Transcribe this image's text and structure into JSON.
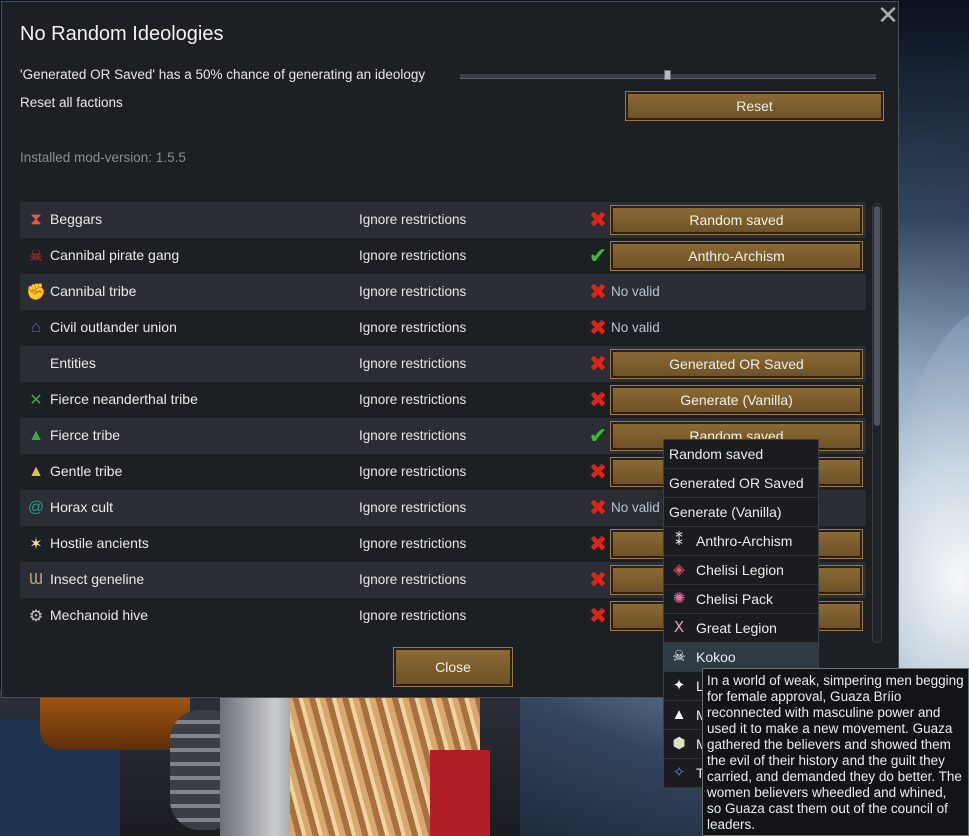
{
  "window": {
    "title": "No Random Ideologies",
    "close_symbol": "✕",
    "chance_label": "'Generated OR Saved' has a 50% chance of generating an ideology",
    "chance_value_percent": 50,
    "reset_all_label": "Reset all factions",
    "reset_button": "Reset",
    "version": "Installed mod-version: 1.5.5",
    "close_button": "Close"
  },
  "factions": [
    {
      "name": "Beggars",
      "icon": "hourglass-icon",
      "icon_color": "#e8554e",
      "ignore_label": "Ignore restrictions",
      "status": "x",
      "value": "Random saved",
      "value_type": "button"
    },
    {
      "name": "Cannibal pirate gang",
      "icon": "skull-icon",
      "icon_color": "#d0323a",
      "ignore_label": "Ignore restrictions",
      "status": "check",
      "value": "Anthro-Archism",
      "value_type": "button"
    },
    {
      "name": "Cannibal tribe",
      "icon": "fist-icon",
      "icon_color": "#d8702a",
      "ignore_label": "Ignore restrictions",
      "status": "x",
      "value": "No valid",
      "value_type": "text"
    },
    {
      "name": "Civil outlander union",
      "icon": "house-icon",
      "icon_color": "#6a5cc8",
      "ignore_label": "Ignore restrictions",
      "status": "x",
      "value": "No valid",
      "value_type": "text"
    },
    {
      "name": "Entities",
      "icon": "",
      "icon_color": "",
      "ignore_label": "Ignore restrictions",
      "status": "x",
      "value": "Generated OR Saved",
      "value_type": "button"
    },
    {
      "name": "Fierce neanderthal tribe",
      "icon": "spear-icon",
      "icon_color": "#3aa84a",
      "ignore_label": "Ignore restrictions",
      "status": "x",
      "value": "Generate (Vanilla)",
      "value_type": "button"
    },
    {
      "name": "Fierce tribe",
      "icon": "leaf-icon",
      "icon_color": "#3aa84a",
      "ignore_label": "Ignore restrictions",
      "status": "check",
      "value": "Random saved",
      "value_type": "button"
    },
    {
      "name": "Gentle tribe",
      "icon": "tent-icon",
      "icon_color": "#e0c24a",
      "ignore_label": "Ignore restrictions",
      "status": "x",
      "value": "",
      "value_type": "button"
    },
    {
      "name": "Horax cult",
      "icon": "spiral-icon",
      "icon_color": "#2a9c8a",
      "ignore_label": "Ignore restrictions",
      "status": "x",
      "value": "No valid",
      "value_type": "text"
    },
    {
      "name": "Hostile ancients",
      "icon": "running-figure-icon",
      "icon_color": "#f0e0b0",
      "ignore_label": "Ignore restrictions",
      "status": "x",
      "value": "",
      "value_type": "button"
    },
    {
      "name": "Insect geneline",
      "icon": "claw-icon",
      "icon_color": "#b8a88a",
      "ignore_label": "Ignore restrictions",
      "status": "x",
      "value": "",
      "value_type": "button"
    },
    {
      "name": "Mechanoid hive",
      "icon": "gear-icon",
      "icon_color": "#c8c8c8",
      "ignore_label": "Ignore restrictions",
      "status": "x",
      "value": "",
      "value_type": "button"
    }
  ],
  "dropdown": {
    "items": [
      {
        "label": "Random saved",
        "icon": "",
        "icon_color": ""
      },
      {
        "label": "Generated OR Saved",
        "icon": "",
        "icon_color": ""
      },
      {
        "label": "Generate (Vanilla)",
        "icon": "",
        "icon_color": ""
      },
      {
        "label": "Anthro-Archism",
        "icon": "hands-icon",
        "icon_color": "#ffffff"
      },
      {
        "label": "Chelisi Legion",
        "icon": "diamond-icon",
        "icon_color": "#e0506a"
      },
      {
        "label": "Chelisi Pack",
        "icon": "splat-icon",
        "icon_color": "#e86aa0"
      },
      {
        "label": "Great Legion",
        "icon": "horns-icon",
        "icon_color": "#e0a0c0"
      },
      {
        "label": "Kokoo",
        "icon": "skull-icon",
        "icon_color": "#ffffff"
      },
      {
        "label": "L",
        "icon": "star-icon",
        "icon_color": "#ffffff"
      },
      {
        "label": "M",
        "icon": "triangle-icon",
        "icon_color": "#ffffff"
      },
      {
        "label": "M",
        "icon": "cube-icon",
        "icon_color": "#e0e0c0"
      },
      {
        "label": "T",
        "icon": "compass-icon",
        "icon_color": "#4a8ae8"
      }
    ]
  },
  "tooltip": {
    "text": "In a world of weak, simpering men begging for female approval, Guaza Bríio reconnected with masculine power and used it to make a new movement. Guaza gathered the believers and showed them the evil of their history and the guilt they carried, and demanded they do better. The women believers wheedled and whined, so Guaza cast them out of the council of leaders."
  },
  "glyphs": {
    "hourglass-icon": "⧗",
    "skull-icon": "☠",
    "fist-icon": "✊",
    "house-icon": "⌂",
    "spear-icon": "✕",
    "leaf-icon": "▲",
    "tent-icon": "▲",
    "spiral-icon": "@",
    "running-figure-icon": "✶",
    "claw-icon": "Ɯ",
    "gear-icon": "⚙",
    "hands-icon": "⁑",
    "diamond-icon": "◈",
    "splat-icon": "✺",
    "horns-icon": "Ⅹ",
    "star-icon": "✦",
    "triangle-icon": "▲",
    "cube-icon": "⬢",
    "compass-icon": "✧",
    "check-mark": "✔",
    "x-mark": "✖"
  }
}
